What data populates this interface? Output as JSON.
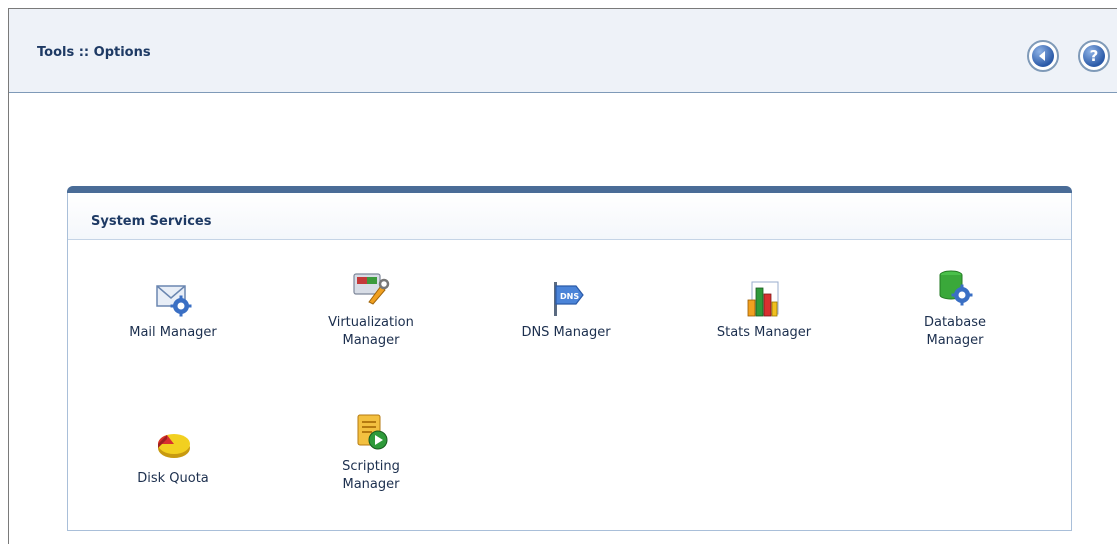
{
  "header": {
    "title": "Tools :: Options",
    "back_glyph": "◀",
    "help_glyph": "?"
  },
  "panel": {
    "title": "System Services",
    "services": [
      {
        "label": "Mail Manager",
        "icon": "mail-settings-icon"
      },
      {
        "label": "Virtualization\nManager",
        "icon": "virtualization-icon"
      },
      {
        "label": "DNS Manager",
        "icon": "dns-sign-icon"
      },
      {
        "label": "Stats Manager",
        "icon": "bar-chart-icon"
      },
      {
        "label": "Database\nManager",
        "icon": "database-settings-icon"
      },
      {
        "label": "Disk Quota",
        "icon": "pie-chart-icon"
      },
      {
        "label": "Scripting\nManager",
        "icon": "script-play-icon"
      }
    ]
  },
  "colors": {
    "header_bg": "#eef2f8",
    "panel_topbar": "#4a6c97",
    "title_text": "#1e3a64",
    "button_blue": "#2b5aa8"
  }
}
